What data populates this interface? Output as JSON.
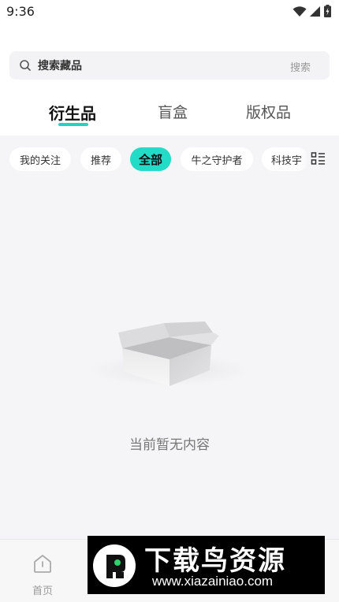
{
  "status_bar": {
    "time": "9:36",
    "icons": [
      "wifi-icon",
      "cellular-signal-icon",
      "battery-charging-icon"
    ]
  },
  "search": {
    "placeholder": "搜索藏品",
    "button_label": "搜索",
    "icon": "search-icon"
  },
  "main_tabs": [
    {
      "label": "衍生品",
      "active": true
    },
    {
      "label": "盲盒",
      "active": false
    },
    {
      "label": "版权品",
      "active": false
    }
  ],
  "categories": [
    {
      "label": "我的关注",
      "active": false
    },
    {
      "label": "推荐",
      "active": false
    },
    {
      "label": "全部",
      "active": true
    },
    {
      "label": "牛之守护者",
      "active": false
    },
    {
      "label": "科技宇",
      "active": false
    }
  ],
  "list_toggle_icon": "list-view-icon",
  "empty_state": {
    "icon": "empty-box-icon",
    "text": "当前暂无内容"
  },
  "bottom_nav": {
    "items": [
      {
        "label": "首页",
        "icon": "home-icon"
      }
    ]
  },
  "watermark": {
    "title": "下载鸟资源",
    "url": "www.xiazainiao.com"
  },
  "colors": {
    "accent": "#22dcc8",
    "background": "#f5f5f7",
    "watermark_bg": "#000000"
  }
}
